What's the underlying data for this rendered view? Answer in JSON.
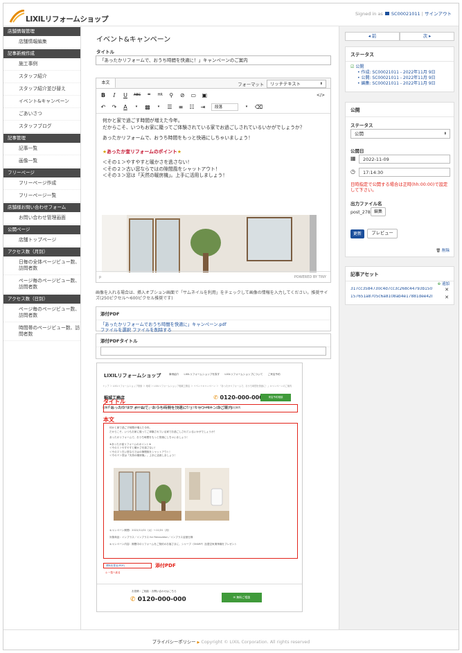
{
  "header": {
    "logo_text": "LIXILリフォームショップ",
    "signed_in": "Signed in as",
    "account": "SC00021011",
    "signout": "サインアウト"
  },
  "sidebar": {
    "sections": [
      {
        "title": "店舗情報管理",
        "items": [
          "店舗情報編集"
        ]
      },
      {
        "title": "記事新規作成",
        "items": [
          "施工事例",
          "スタッフ紹介",
          "スタッフ紹介並び替え",
          "イベント&キャンペーン",
          "ごあいさつ",
          "スタッフブログ"
        ]
      },
      {
        "title": "記事管理",
        "items": [
          "記事一覧",
          "画像一覧"
        ]
      },
      {
        "title": "フリーページ",
        "items": [
          "フリーページ作成",
          "フリーページ一覧"
        ]
      },
      {
        "title": "店舗様お問い合わせフォーム",
        "items": [
          "お問い合わせ管理画面"
        ]
      },
      {
        "title": "公開ページ",
        "items": [
          "店舗トップページ"
        ]
      },
      {
        "title": "アクセス数（月別）",
        "items": [
          "日毎の全体ページビュー数、訪問者数",
          "ページ毎のページビュー数、訪問者数"
        ]
      },
      {
        "title": "アクセス数（日別）",
        "items": [
          "ページ毎のページビュー数、訪問者数",
          "時間帯のページビュー数、訪問者数"
        ]
      }
    ]
  },
  "main": {
    "page_title": "イベント&キャンペーン",
    "title_label": "タイトル",
    "title_value": "「あったかリフォームで、おうち時間を快適に！」キャンペーンのご案内",
    "editor": {
      "tab": "本文",
      "format_label": "フォーマット",
      "format_value": "リッチテキスト",
      "paragraph_select": "段落",
      "body": {
        "p1": "何かと家で過ごす時間が増えた今年。",
        "p2": "だからこそ、いつもお家に籠ってご体験されている家でお過ごしされているいかがでしょうか？",
        "p3": "あったかリフォームで、おうち時間をもっと快適にしちゃいましょう！",
        "point_star1": "★",
        "point_text": "あったか宣リフォームのポイント",
        "point_star2": "★",
        "l1": "＜その１＞やすやすと暖かさを逃さない！",
        "l2": "＜その２＞古い窓ならではの隙間風をシャットアウト！",
        "l3": "＜その３＞窓は「天然の暖房機」。上手に活用しましょう！"
      },
      "path": "p",
      "powered": "POWERED BY TINY"
    },
    "image_hint": "画像を入れる場合は、挿入オプション画面で「サムネイルを利用」をチェックして画像の情報を入力してください。推奨サイズ(250ピクセル～600ピクセル推奨です)",
    "pdf": {
      "label": "添付PDF",
      "file": "「あったかリフォームでおうち時間を快適に」キャンペーン.pdf",
      "actions": "ファイルを選択 ファイルを削除する"
    },
    "pdf_title": {
      "label": "添付PDFタイトル",
      "value": ""
    },
    "preview": {
      "logo": "LIXILリフォームショップ",
      "nav": "事例紹介　　LIXILリフォームショップを探す　　LIXILリフォームショップについて　　ご来店予約",
      "crumb": "トップ ＞ LIXILリフォームショップ検索 ＞ 地域 ＞ LIXILリフォームショップ稲城工務店 ＞ イベントキャンペーン ＞ 「あったかリフォームで、おうち時間を快適に！」キャンペーンのご案内",
      "shop": "稲城工務店",
      "phone": "0120-000-000",
      "reserve": "来店予約相談",
      "menu": "店舗ホーム　 スタッフ紹介　 施工事例　 イベント&キャンペーン　 スタッフブログ　 おすすめ商品　 ごあいさつ　 会社案内",
      "title_label": "タイトル",
      "title_text": "「あったかリフォームで、おうち時間を快適に！」キャンペーンのご案内",
      "body_label": "本文",
      "b1": "何かと家で過ごす時間が増えた今年。",
      "b2": "だからこそ、いつもお家に籠ってご体験されている家でお過ごしされているいかがでしょうか？",
      "b3": "あったかリフォームで、おうち時間をもっと快適にしちゃいましょう！",
      "b4": "★あったか宣リフォームのポイント★",
      "b5": "＜その１＞やすやすと暖かさを逃さない！",
      "b6": "＜その２＞古い窓ならではの隙間風をシャットアウト！",
      "b7": "＜その３＞窓は「天然の暖房機」。上手に活用しましょう！",
      "period": "キャンペーン期間：2022/11/01（火）～11/31（月）",
      "target": "対象商品：インプラス／インプラス for Renovation／インプラス浴室仕様",
      "content": "キャンペーン内容：期間中のリフォームをご契約のお客さまに、シャープ（SHARP）加湿空気清浄機をプレゼント",
      "pdf_link": "資料を見る(PDF)",
      "pdf_label": "添付PDF",
      "back": "◎ 一覧へ戻る",
      "footer_copy": "お見積・ご相談・お問い合わせはこちら",
      "footer_phone": "0120-000-000",
      "footer_btn": "無料ご相談"
    }
  },
  "right": {
    "prev": "◂ 前",
    "next": "次 ▸",
    "status": {
      "title": "ステータス",
      "checkbox": "公開",
      "created": "作成: SC00021011 - 2022年11月 9日",
      "published": "公開: SC00021011 - 2022年11月 9日",
      "edited": "編集: SC00021011 - 2022年11月 9日"
    },
    "publish": {
      "title": "公開",
      "status_label": "ステータス",
      "status_value": "公開",
      "date_label": "公開日",
      "date_value": "2022-11-09",
      "time_value": "17:14:30",
      "note": "日時指定で公開する場合は正時(hh:00:00)で設定して下さい。",
      "file_label": "出力ファイル名",
      "file_value": "post_278",
      "edit": "編集",
      "update": "更新",
      "preview": "プレビュー",
      "delete": "削除"
    },
    "assets": {
      "title": "記事アセット",
      "add": "追加",
      "items": [
        "317cc3584730c4d7cc3c268c44793b15019d3...",
        "157651a8705c6a8108ab4e17881dee42b0a93..."
      ]
    }
  },
  "footer": {
    "privacy": "プライバシーポリシー",
    "arrow": "▶",
    "copyright": "Copyright © LIXIL Corporation. All rights reserved"
  }
}
